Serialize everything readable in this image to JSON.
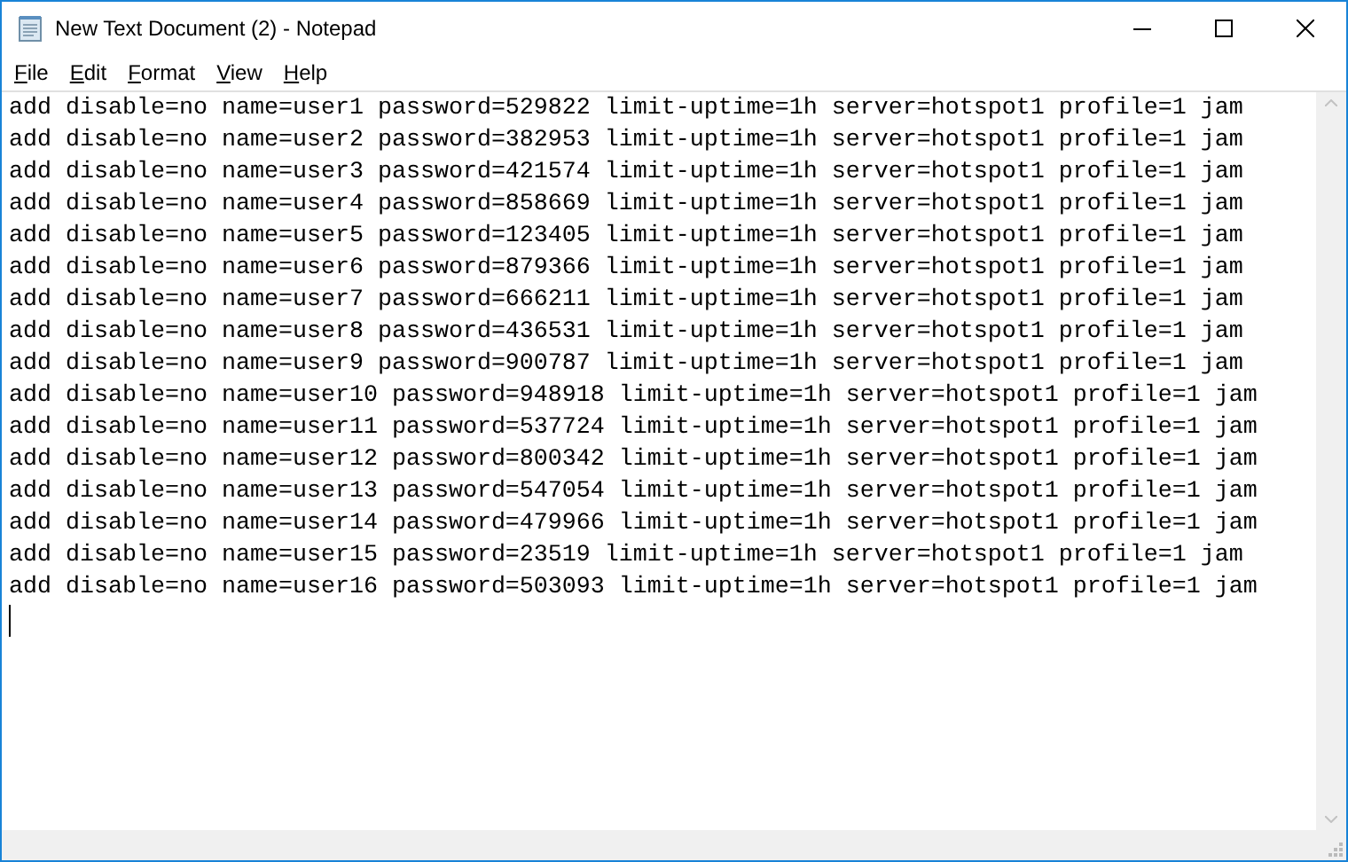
{
  "window": {
    "title": "New Text Document (2) - Notepad"
  },
  "menu": [
    {
      "label": "File"
    },
    {
      "label": "Edit"
    },
    {
      "label": "Format"
    },
    {
      "label": "View"
    },
    {
      "label": "Help"
    }
  ],
  "lines": [
    "add disable=no name=user1 password=529822 limit-uptime=1h server=hotspot1 profile=1 jam",
    "add disable=no name=user2 password=382953 limit-uptime=1h server=hotspot1 profile=1 jam",
    "add disable=no name=user3 password=421574 limit-uptime=1h server=hotspot1 profile=1 jam",
    "add disable=no name=user4 password=858669 limit-uptime=1h server=hotspot1 profile=1 jam",
    "add disable=no name=user5 password=123405 limit-uptime=1h server=hotspot1 profile=1 jam",
    "add disable=no name=user6 password=879366 limit-uptime=1h server=hotspot1 profile=1 jam",
    "add disable=no name=user7 password=666211 limit-uptime=1h server=hotspot1 profile=1 jam",
    "add disable=no name=user8 password=436531 limit-uptime=1h server=hotspot1 profile=1 jam",
    "add disable=no name=user9 password=900787 limit-uptime=1h server=hotspot1 profile=1 jam",
    "add disable=no name=user10 password=948918 limit-uptime=1h server=hotspot1 profile=1 jam",
    "add disable=no name=user11 password=537724 limit-uptime=1h server=hotspot1 profile=1 jam",
    "add disable=no name=user12 password=800342 limit-uptime=1h server=hotspot1 profile=1 jam",
    "add disable=no name=user13 password=547054 limit-uptime=1h server=hotspot1 profile=1 jam",
    "add disable=no name=user14 password=479966 limit-uptime=1h server=hotspot1 profile=1 jam",
    "add disable=no name=user15 password=23519 limit-uptime=1h server=hotspot1 profile=1 jam",
    "add disable=no name=user16 password=503093 limit-uptime=1h server=hotspot1 profile=1 jam"
  ]
}
